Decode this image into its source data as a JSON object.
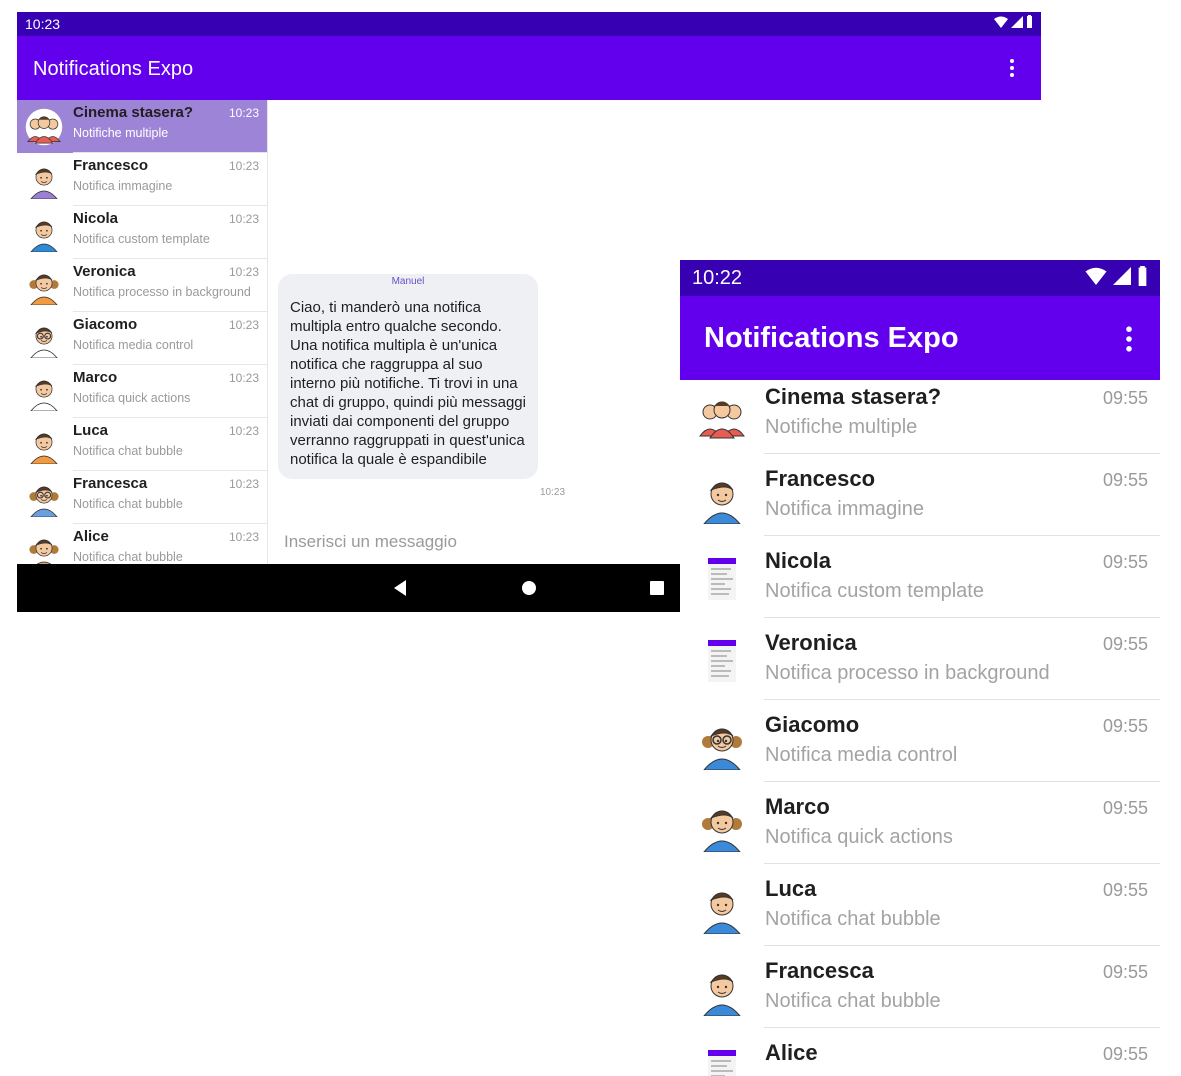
{
  "tablet": {
    "status_time": "10:23",
    "app_title": "Notifications Expo",
    "conversations": [
      {
        "name": "Cinema stasera?",
        "subtitle": "Notifiche multiple",
        "time": "10:23",
        "selected": true,
        "avatar": "group-avatar-icon",
        "color": "#e85c52"
      },
      {
        "name": "Francesco",
        "subtitle": "Notifica immagine",
        "time": "10:23",
        "avatar": "elder-man-avatar-icon",
        "color": "#9a7fd2"
      },
      {
        "name": "Nicola",
        "subtitle": "Notifica custom template",
        "time": "10:23",
        "avatar": "man-avatar-icon",
        "color": "#2d8ad9"
      },
      {
        "name": "Veronica",
        "subtitle": "Notifica processo in background",
        "time": "10:23",
        "avatar": "woman-avatar-icon",
        "color": "#f29a40"
      },
      {
        "name": "Giacomo",
        "subtitle": "Notifica media control",
        "time": "10:23",
        "avatar": "man-glasses-avatar-icon",
        "color": "#ffffff"
      },
      {
        "name": "Marco",
        "subtitle": "Notifica quick actions",
        "time": "10:23",
        "avatar": "businessman-avatar-icon",
        "color": "#ffffff"
      },
      {
        "name": "Luca",
        "subtitle": "Notifica chat bubble",
        "time": "10:23",
        "avatar": "boy-avatar-icon",
        "color": "#f29a40"
      },
      {
        "name": "Francesca",
        "subtitle": "Notifica chat bubble",
        "time": "10:23",
        "avatar": "girl-glasses-avatar-icon",
        "color": "#6aa0e0"
      },
      {
        "name": "Alice",
        "subtitle": "Notifica chat bubble",
        "time": "10:23",
        "avatar": "girl-pigtails-avatar-icon",
        "color": "#e0a56a"
      }
    ],
    "chat": {
      "sender": "Manuel",
      "message": "Ciao, ti manderò una notifica multipla entro qualche secondo. Una notifica multipla è un'unica notifica che raggruppa al suo interno più notifiche. Ti trovi in una chat di gruppo, quindi più messaggi inviati dai componenti del gruppo verranno raggruppati in quest'unica notifica la quale è espandibile",
      "time": "10:23",
      "input_placeholder": "Inserisci un messaggio"
    }
  },
  "phone": {
    "status_time": "10:22",
    "app_title": "Notifications Expo",
    "conversations": [
      {
        "name": "Cinema stasera?",
        "subtitle": "Notifiche multiple",
        "time": "09:55",
        "avatar": "group-avatar-icon"
      },
      {
        "name": "Francesco",
        "subtitle": "Notifica immagine",
        "time": "09:55",
        "avatar": "man-avatar-icon"
      },
      {
        "name": "Nicola",
        "subtitle": "Notifica custom template",
        "time": "09:55",
        "avatar": "screenshot-thumbnail-icon"
      },
      {
        "name": "Veronica",
        "subtitle": "Notifica processo in background",
        "time": "09:55",
        "avatar": "screenshot-thumbnail-icon"
      },
      {
        "name": "Giacomo",
        "subtitle": "Notifica media control",
        "time": "09:55",
        "avatar": "woman-glasses-avatar-icon"
      },
      {
        "name": "Marco",
        "subtitle": "Notifica quick actions",
        "time": "09:55",
        "avatar": "girl-pigtails-avatar-icon"
      },
      {
        "name": "Luca",
        "subtitle": "Notifica chat bubble",
        "time": "09:55",
        "avatar": "businessman-avatar-icon"
      },
      {
        "name": "Francesca",
        "subtitle": "Notifica chat bubble",
        "time": "09:55",
        "avatar": "man-beard-avatar-icon"
      },
      {
        "name": "Alice",
        "subtitle": "",
        "time": "09:55",
        "avatar": "screenshot-thumbnail-icon"
      }
    ]
  },
  "colors": {
    "status_bar": "#3700b3",
    "app_bar": "#6200ee",
    "selected_row": "#9e84d6",
    "bubble": "#eef0f4"
  }
}
